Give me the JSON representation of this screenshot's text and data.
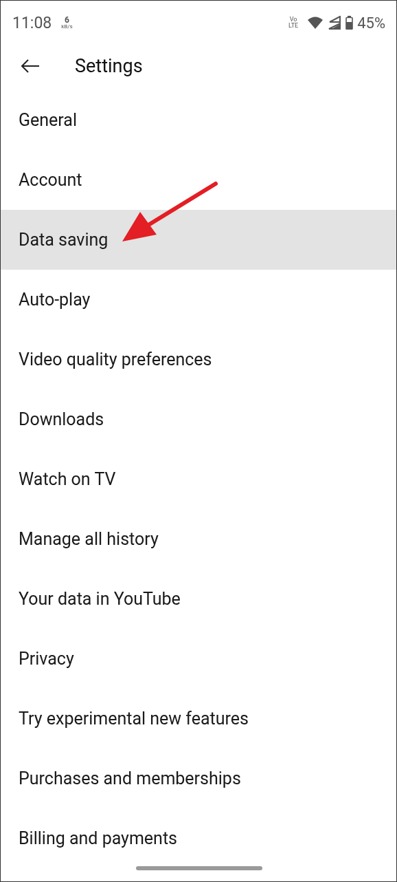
{
  "status_bar": {
    "time": "11:08",
    "speed_value": "6",
    "speed_unit": "kB/s",
    "network": "Vo LTE",
    "battery": "45%"
  },
  "header": {
    "title": "Settings"
  },
  "items": [
    {
      "label": "General",
      "selected": false
    },
    {
      "label": "Account",
      "selected": false
    },
    {
      "label": "Data saving",
      "selected": true
    },
    {
      "label": "Auto-play",
      "selected": false
    },
    {
      "label": "Video quality preferences",
      "selected": false
    },
    {
      "label": "Downloads",
      "selected": false
    },
    {
      "label": "Watch on TV",
      "selected": false
    },
    {
      "label": "Manage all history",
      "selected": false
    },
    {
      "label": "Your data in YouTube",
      "selected": false
    },
    {
      "label": "Privacy",
      "selected": false
    },
    {
      "label": "Try experimental new features",
      "selected": false
    },
    {
      "label": "Purchases and memberships",
      "selected": false
    },
    {
      "label": "Billing and payments",
      "selected": false
    }
  ]
}
